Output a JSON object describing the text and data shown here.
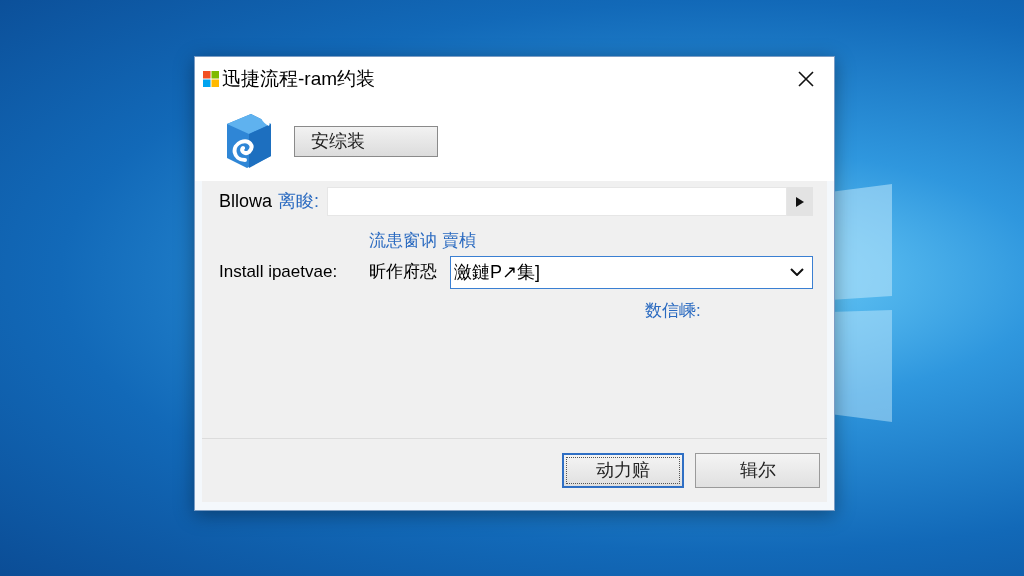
{
  "window": {
    "title": "迅捷流程-ram约装"
  },
  "header": {
    "button": "安综装"
  },
  "browse_row": {
    "label": "Bllowa",
    "label_note": "离睃:"
  },
  "install_row": {
    "hint": "流患窗讷 賣楨",
    "label": "Install ipaetvae:",
    "sub_label": "昕作府恐",
    "value": "瀲鏈P↗集]",
    "focused": true,
    "note": "数信嵊:"
  },
  "buttons": [
    {
      "label": "动力赔",
      "default": true
    },
    {
      "label": "辑尔",
      "default": false
    }
  ]
}
